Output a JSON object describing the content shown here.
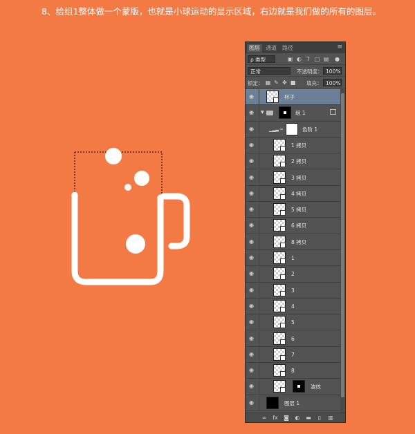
{
  "caption": "8、给组1整体做一个蒙版，也就是小球运动的显示区域，右边就是我们做的所有的图层。",
  "colors": {
    "background": "#f37a45",
    "panel": "#535353",
    "selected": "#6b7f97"
  },
  "panel": {
    "tabs": [
      "图层",
      "通道",
      "路径"
    ],
    "filter": {
      "kind_label": "ρ 类型"
    },
    "blend": {
      "mode": "正常",
      "opacity_label": "不透明度：",
      "opacity": "100%"
    },
    "lock": {
      "label": "锁定：",
      "fill_label": "填充：",
      "fill": "100%"
    },
    "layers": [
      {
        "name": "杯子",
        "type": "pixel",
        "selected": true
      },
      {
        "name": "组 1",
        "type": "group"
      },
      {
        "name": "色阶 1",
        "type": "adjustment"
      },
      {
        "name": "1 拷贝",
        "type": "smart"
      },
      {
        "name": "2 拷贝",
        "type": "smart"
      },
      {
        "name": "3 拷贝",
        "type": "smart"
      },
      {
        "name": "4 拷贝",
        "type": "smart"
      },
      {
        "name": "5 拷贝",
        "type": "smart"
      },
      {
        "name": "6 拷贝",
        "type": "smart"
      },
      {
        "name": "8 拷贝",
        "type": "smart"
      },
      {
        "name": "1",
        "type": "smart"
      },
      {
        "name": "2",
        "type": "smart"
      },
      {
        "name": "3",
        "type": "smart"
      },
      {
        "name": "4",
        "type": "smart"
      },
      {
        "name": "5",
        "type": "smart"
      },
      {
        "name": "6",
        "type": "smart"
      },
      {
        "name": "7",
        "type": "smart"
      },
      {
        "name": "8",
        "type": "smart"
      },
      {
        "name": "波纹",
        "type": "masked"
      },
      {
        "name": "图层 1",
        "type": "fill"
      }
    ],
    "footer_icons": [
      "link-icon",
      "fx-icon",
      "add-mask-icon",
      "adjustment-icon",
      "new-group-icon",
      "new-layer-icon",
      "trash-icon"
    ]
  }
}
